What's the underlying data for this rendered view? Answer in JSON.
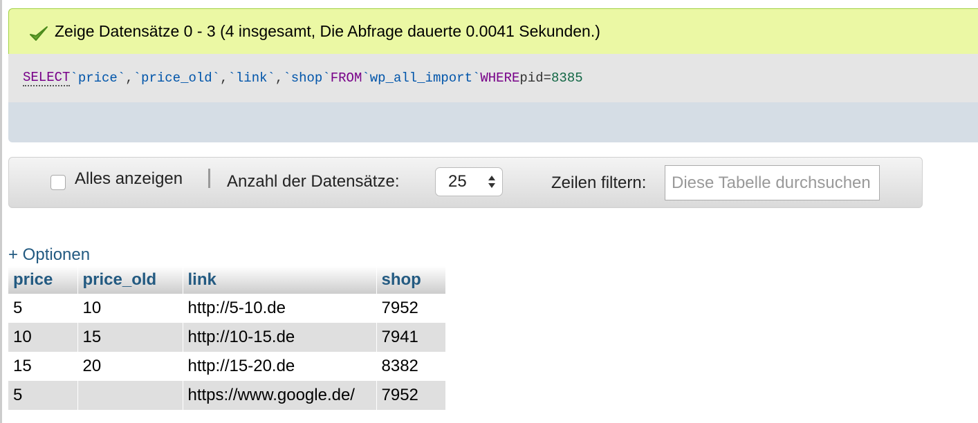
{
  "success_message": "Zeige Datensätze 0 - 3 (4 insgesamt, Die Abfrage dauerte 0.0041 Sekunden.)",
  "sql": {
    "select": "SELECT",
    "col1": "`price`",
    "comma": ",",
    "col2": "`price_old`",
    "col3": "`link`",
    "col4": "`shop`",
    "from": "FROM",
    "table": "`wp_all_import`",
    "where": "WHERE",
    "field": "pid",
    "op": "=",
    "value": "8385"
  },
  "navigation": {
    "show_all_label": "Alles anzeigen",
    "rows_label": "Anzahl der Datensätze:",
    "rows_value": "25",
    "filter_label": "Zeilen filtern:",
    "filter_placeholder": "Diese Tabelle durchsuchen"
  },
  "options_link": "+ Optionen",
  "table": {
    "columns": [
      "price",
      "price_old",
      "link",
      "shop"
    ],
    "rows": [
      [
        "5",
        "10",
        "http://5-10.de",
        "7952"
      ],
      [
        "10",
        "15",
        "http://10-15.de",
        "7941"
      ],
      [
        "15",
        "20",
        "http://15-20.de",
        "8382"
      ],
      [
        "5",
        "",
        "https://www.google.de/",
        "7952"
      ]
    ]
  },
  "colors": {
    "success_bg": "#ebf8a4",
    "sql_bg": "#e5e5e5",
    "keyword": "#770088",
    "identifier": "#0055aa",
    "number": "#116644",
    "header_link": "#235a81",
    "row_even": "#dfdfdf"
  },
  "icons": {
    "success": "check-icon",
    "rows_select": "updown-arrows-icon"
  }
}
